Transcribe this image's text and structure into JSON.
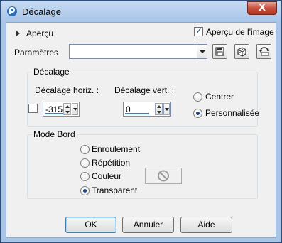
{
  "window": {
    "title": "Décalage",
    "close_label": "X"
  },
  "top": {
    "apercu_label": "Aperçu",
    "preview_checkbox_label": "Aperçu de l'image",
    "preview_checked": true,
    "params_label": "Paramètres",
    "params_value": ""
  },
  "offset_group": {
    "legend": "Décalage",
    "horiz_label": "Décalage horiz. :",
    "vert_label": "Décalage vert. :",
    "horiz_value": "-315",
    "vert_value": "0",
    "center_label": "Centrer",
    "custom_label": "Personnalisée",
    "selected": "custom"
  },
  "edge_group": {
    "legend": "Mode Bord",
    "options": [
      "Enroulement",
      "Répétition",
      "Couleur",
      "Transparent"
    ],
    "selected": "Transparent"
  },
  "buttons": {
    "ok": "OK",
    "cancel": "Annuler",
    "help": "Aide"
  }
}
